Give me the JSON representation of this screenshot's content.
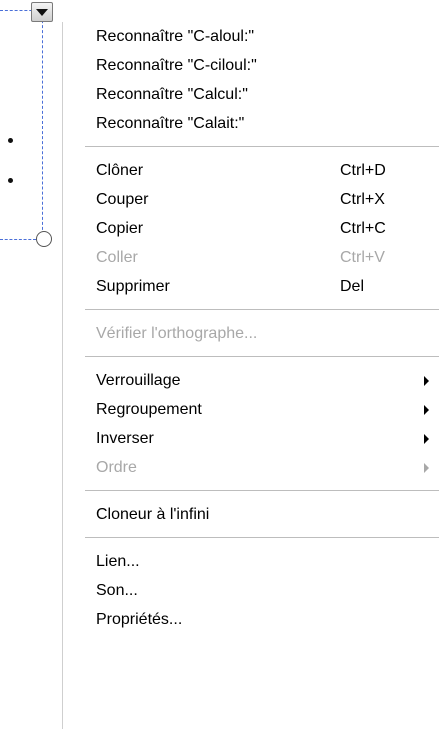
{
  "menu": {
    "groups": [
      [
        {
          "label": "Reconnaître \"C-aloul:\"",
          "enabled": true
        },
        {
          "label": "Reconnaître \"C-ciloul:\"",
          "enabled": true
        },
        {
          "label": "Reconnaître \"Calcul:\"",
          "enabled": true
        },
        {
          "label": "Reconnaître \"Calait:\"",
          "enabled": true
        }
      ],
      [
        {
          "label": "Clôner",
          "shortcut": "Ctrl+D",
          "enabled": true
        },
        {
          "label": "Couper",
          "shortcut": "Ctrl+X",
          "enabled": true
        },
        {
          "label": "Copier",
          "shortcut": "Ctrl+C",
          "enabled": true
        },
        {
          "label": "Coller",
          "shortcut": "Ctrl+V",
          "enabled": false
        },
        {
          "label": "Supprimer",
          "shortcut": "Del",
          "enabled": true
        }
      ],
      [
        {
          "label": "Vérifier l'orthographe...",
          "enabled": false
        }
      ],
      [
        {
          "label": "Verrouillage",
          "submenu": true,
          "enabled": true
        },
        {
          "label": "Regroupement",
          "submenu": true,
          "enabled": true
        },
        {
          "label": "Inverser",
          "submenu": true,
          "enabled": true
        },
        {
          "label": "Ordre",
          "submenu": true,
          "enabled": false
        }
      ],
      [
        {
          "label": "Cloneur à l'infini",
          "enabled": true
        }
      ],
      [
        {
          "label": "Lien...",
          "enabled": true
        },
        {
          "label": "Son...",
          "enabled": true
        },
        {
          "label": "Propriétés...",
          "enabled": true
        }
      ]
    ]
  },
  "icons": {
    "dropdown": "chevron-down-icon",
    "submenu": "submenu-arrow-icon"
  },
  "colors": {
    "disabled_text": "#a8a8a8",
    "selection_outline": "#4a6fd8"
  }
}
